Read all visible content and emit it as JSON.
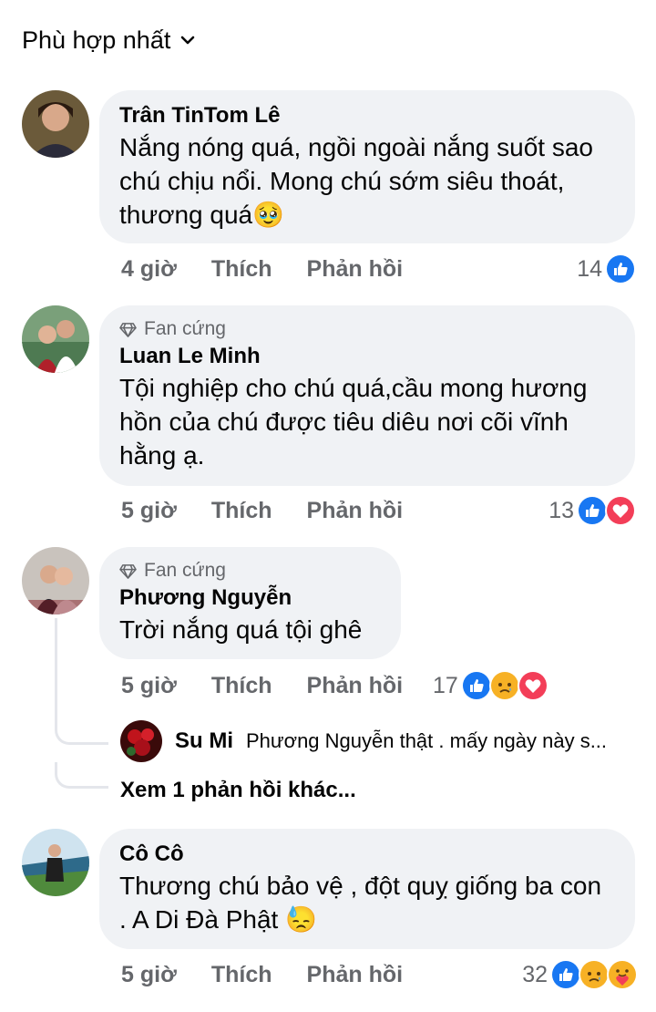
{
  "sort": {
    "label": "Phù hợp nhất",
    "icon": "chevron-down-icon"
  },
  "comments": [
    {
      "author": "Trân TinTom Lê",
      "badge": "",
      "text": "Nắng nóng quá, ngồi ngoài nắng suốt sao chú chịu nổi. Mong chú sớm siêu thoát, thương quá🥹",
      "time": "4 giờ",
      "like": "Thích",
      "reply": "Phản hồi",
      "count": "14",
      "reactions": [
        "like-icon"
      ]
    },
    {
      "author": "Luan Le Minh",
      "badge": "Fan cứng",
      "text": "Tội nghiệp cho chú quá,cầu mong hương hồn của chú được tiêu diêu nơi cõi vĩnh hằng ạ.",
      "time": "5 giờ",
      "like": "Thích",
      "reply": "Phản hồi",
      "count": "13",
      "reactions": [
        "like-icon",
        "love-icon"
      ]
    },
    {
      "author": "Phương Nguyễn",
      "badge": "Fan cứng",
      "text": "Trời nắng quá tội ghê",
      "time": "5 giờ",
      "like": "Thích",
      "reply": "Phản hồi",
      "count": "17",
      "reactions": [
        "like-icon",
        "sad-icon",
        "love-icon"
      ],
      "reply_preview": {
        "author": "Su Mi",
        "text": "Phương Nguyễn  thật . mấy ngày này s..."
      },
      "more_replies": "Xem 1 phản hồi khác..."
    },
    {
      "author": "Cô Cô",
      "badge": "",
      "text": "Thương chú bảo vệ , đột quỵ giống ba con . A Di Đà Phật 😓",
      "time": "5 giờ",
      "like": "Thích",
      "reply": "Phản hồi",
      "count": "32",
      "reactions": [
        "like-icon",
        "sad-icon",
        "care-icon"
      ]
    }
  ],
  "colors": {
    "bubble": "#f0f2f5",
    "meta": "#65676b",
    "like": "#1877f2",
    "love": "#f33e58",
    "sad": "#f7b125"
  }
}
